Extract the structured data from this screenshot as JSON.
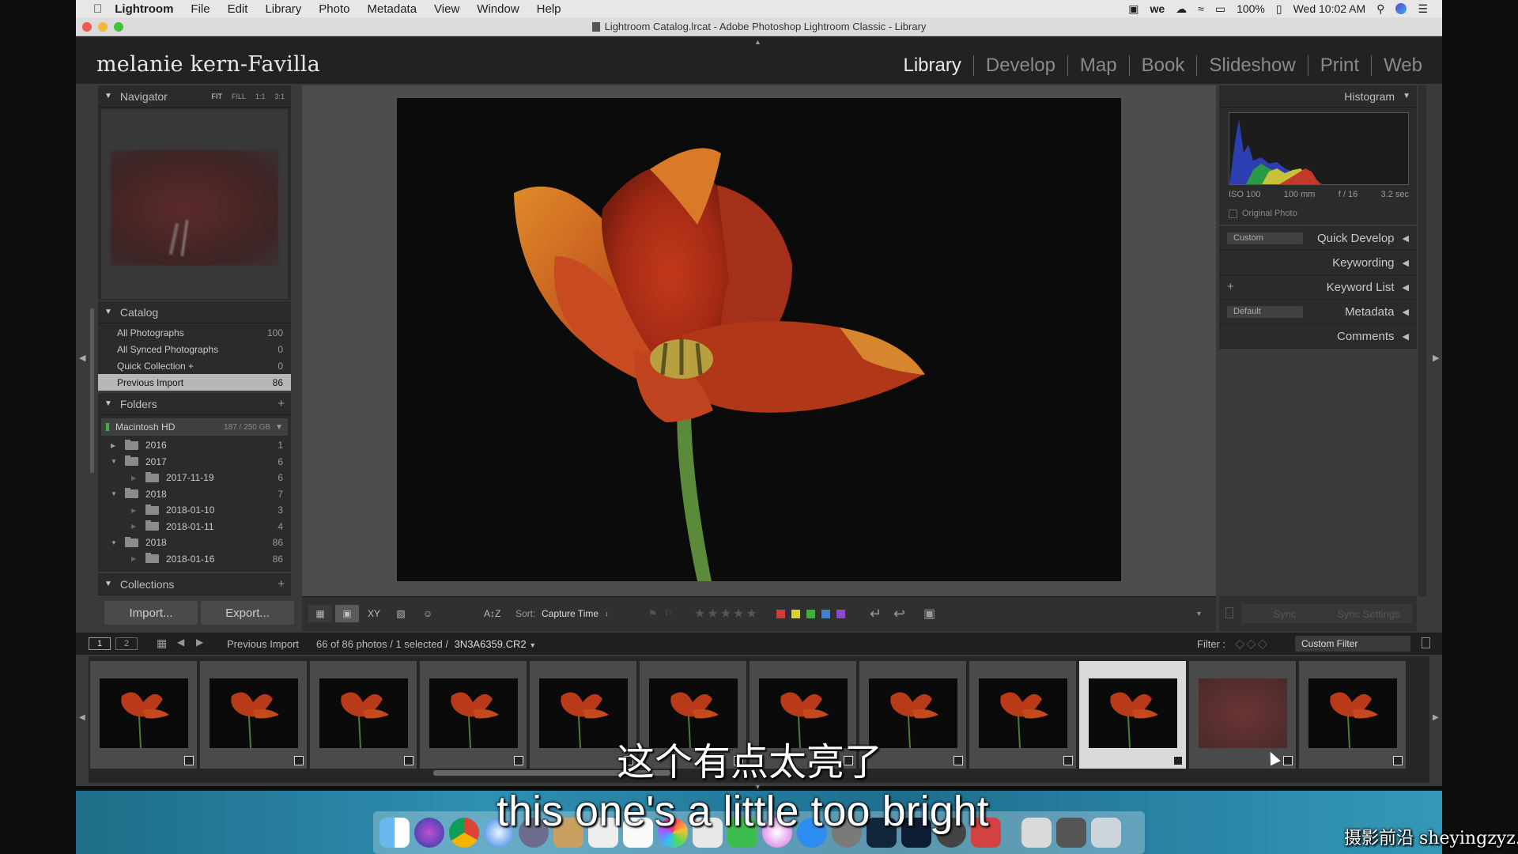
{
  "menubar": {
    "app": "Lightroom",
    "items": [
      "File",
      "Edit",
      "Library",
      "Photo",
      "Metadata",
      "View",
      "Window",
      "Help"
    ],
    "battery": "100%",
    "clock": "Wed 10:02 AM"
  },
  "window": {
    "title": "Lightroom Catalog.lrcat - Adobe Photoshop Lightroom Classic - Library"
  },
  "identity_plate": "melanie kern-Favilla",
  "modules": [
    "Library",
    "Develop",
    "Map",
    "Book",
    "Slideshow",
    "Print",
    "Web"
  ],
  "navigator": {
    "title": "Navigator",
    "zoom": [
      "FIT",
      "FILL",
      "1:1",
      "3:1"
    ]
  },
  "catalog": {
    "title": "Catalog",
    "items": [
      {
        "label": "All Photographs",
        "count": "100"
      },
      {
        "label": "All Synced Photographs",
        "count": "0"
      },
      {
        "label": "Quick Collection +",
        "count": "0"
      },
      {
        "label": "Previous Import",
        "count": "86"
      }
    ]
  },
  "folders": {
    "title": "Folders",
    "plus": "+",
    "volume": "Macintosh HD",
    "volume_usage": "187 / 250 GB",
    "items": [
      {
        "label": "2016",
        "count": "1",
        "level": 0,
        "open": false
      },
      {
        "label": "2017",
        "count": "6",
        "level": 0,
        "open": true
      },
      {
        "label": "2017-11-19",
        "count": "6",
        "level": 1,
        "open": false
      },
      {
        "label": "2018",
        "count": "7",
        "level": 0,
        "open": true
      },
      {
        "label": "2018-01-10",
        "count": "3",
        "level": 1,
        "open": false
      },
      {
        "label": "2018-01-11",
        "count": "4",
        "level": 1,
        "open": false
      },
      {
        "label": "2018",
        "count": "86",
        "level": 0,
        "open": true
      },
      {
        "label": "2018-01-16",
        "count": "86",
        "level": 1,
        "open": false
      }
    ]
  },
  "collections": {
    "title": "Collections",
    "plus": "+"
  },
  "buttons": {
    "import": "Import...",
    "export": "Export..."
  },
  "histogram": {
    "title": "Histogram",
    "iso": "ISO 100",
    "focal": "100 mm",
    "aperture": "f / 16",
    "shutter": "3.2 sec",
    "original_photo": "Original Photo"
  },
  "right_panels": {
    "quick_develop": "Quick Develop",
    "keywording": "Keywording",
    "keyword_list": "Keyword List",
    "metadata": "Metadata",
    "comments": "Comments",
    "qd_preset": "Custom",
    "md_preset": "Default",
    "keyword_plus": "+",
    "sync": "Sync",
    "sync_settings": "Sync Settings"
  },
  "toolbar": {
    "sort_label": "Sort:",
    "sort_value": "Capture Time",
    "label_colors": [
      "#d23b3b",
      "#d8d231",
      "#3fae3f",
      "#3f7fd6",
      "#8a49c8"
    ]
  },
  "secondary": {
    "page1": "1",
    "page2": "2",
    "source": "Previous Import",
    "status": "66 of 86 photos / 1 selected /",
    "filename": "3N3A6359.CR2",
    "filter_label": "Filter :",
    "filter_value": "Custom Filter"
  },
  "filmstrip": {
    "count": 12,
    "selected_index": 9,
    "overexposed_index": 10
  },
  "subtitles": {
    "zh": "这个有点太亮了",
    "en": "this one's a little too bright"
  },
  "watermark": "摄影前沿 sheyingzyz.com"
}
